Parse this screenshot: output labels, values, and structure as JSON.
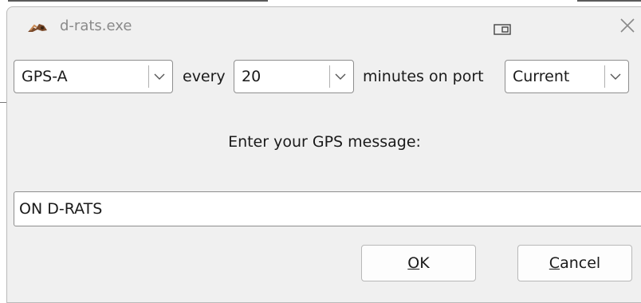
{
  "window": {
    "title": "d-rats.exe"
  },
  "gps_row": {
    "station_type": "GPS-A",
    "every_label": "every",
    "interval": "20",
    "minutes_label": "minutes on port",
    "port": "Current"
  },
  "message": {
    "prompt": "Enter your GPS message:",
    "value": "ON D-RATS"
  },
  "buttons": {
    "ok_accel": "O",
    "ok_rest": "K",
    "cancel_accel": "C",
    "cancel_rest": "ancel"
  },
  "icons": {
    "app": "d-rats-logo-icon",
    "snap": "snap-layout-icon",
    "close": "close-icon",
    "dropdown": "chevron-down-icon"
  },
  "colors": {
    "dialog_background": "#f0f0f0",
    "title_text": "#8a8a8a",
    "field_border": "#8e8e8e"
  }
}
